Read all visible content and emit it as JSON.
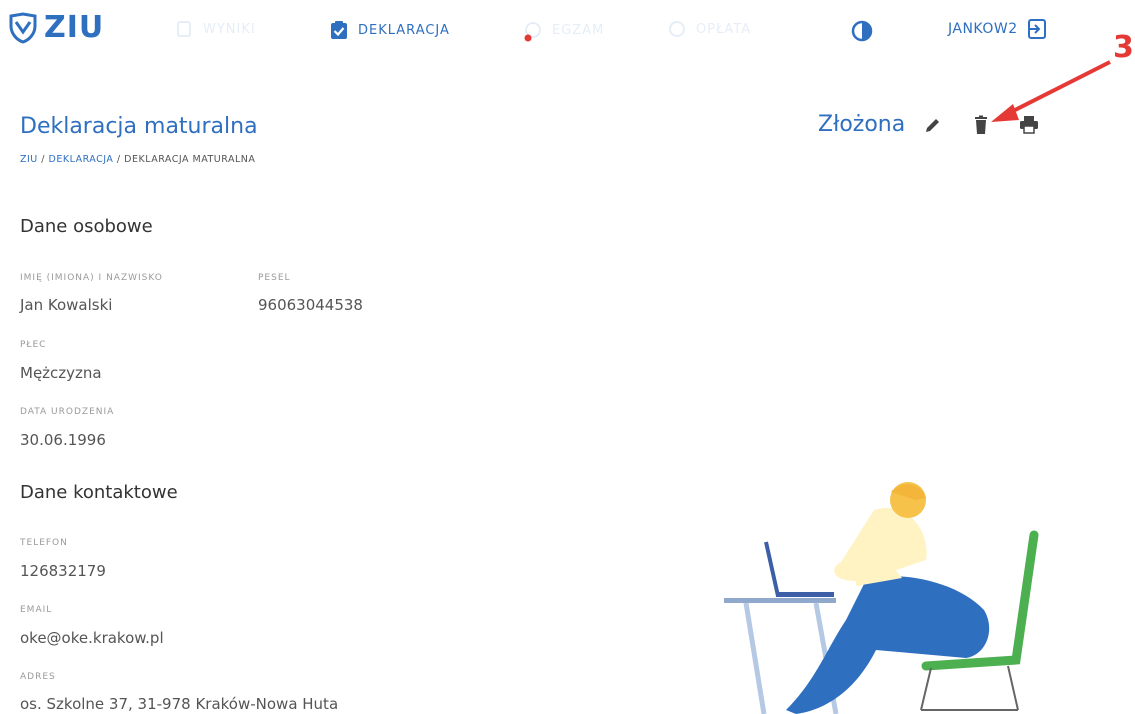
{
  "nav": {
    "logo_text": "ZIU",
    "items": [
      {
        "label": "WYNIKI",
        "faded": true
      },
      {
        "label": "DEKLARACJA",
        "faded": false
      },
      {
        "label": "EGZAM",
        "faded": true
      },
      {
        "label": "OPŁATA",
        "faded": true
      }
    ],
    "user": "JANKOW2"
  },
  "header": {
    "title": "Deklaracja maturalna",
    "breadcrumb": [
      "ZIU",
      "DEKLARACJA",
      "DEKLARACJA MATURALNA"
    ],
    "breadcrumb_sep": " / ",
    "status": "Złożona",
    "annotation_number": "3"
  },
  "personal": {
    "section_title": "Dane osobowe",
    "name_label": "IMIĘ (IMIONA) I NAZWISKO",
    "name_value": "Jan Kowalski",
    "pesel_label": "PESEL",
    "pesel_value": "96063044538",
    "gender_label": "PŁEC",
    "gender_value": "Mężczyzna",
    "birth_label": "DATA URODZENIA",
    "birth_value": "30.06.1996"
  },
  "contact": {
    "section_title": "Dane kontaktowe",
    "phone_label": "TELEFON",
    "phone_value": "126832179",
    "email_label": "EMAIL",
    "email_value": "oke@oke.krakow.pl",
    "address_label": "ADRES",
    "address_value": "os. Szkolne 37, 31-978 Kraków-Nowa Huta"
  },
  "colors": {
    "brand": "#2f6fc0",
    "annotation": "#e53935"
  }
}
